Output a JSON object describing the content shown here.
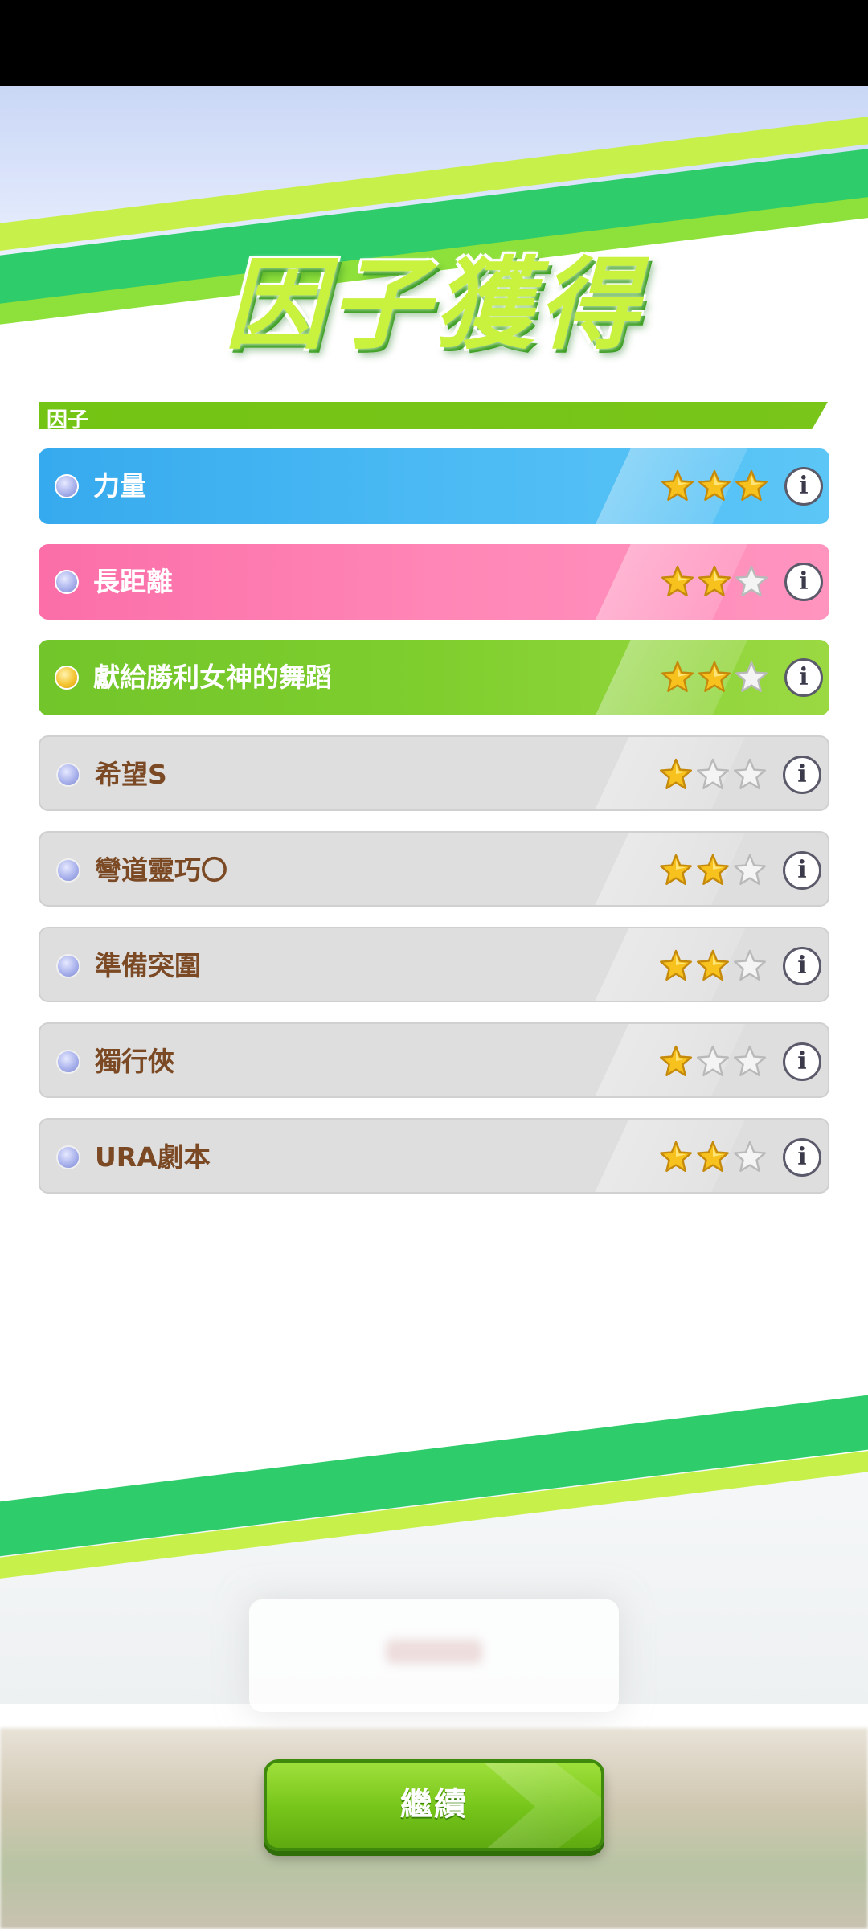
{
  "title": "因子獲得",
  "section_label": "因子",
  "factors": [
    {
      "name": "力量",
      "stars": 3,
      "color": "blue",
      "dot": "blue-gem-icon"
    },
    {
      "name": "長距離",
      "stars": 2,
      "color": "pink",
      "dot": "blue-gem-icon"
    },
    {
      "name": "獻給勝利女神的舞蹈",
      "stars": 2,
      "color": "green",
      "dot": "gold-gem-icon"
    },
    {
      "name": "希望S",
      "stars": 1,
      "color": "gray",
      "dot": "blue-gem-icon"
    },
    {
      "name": "彎道靈巧〇",
      "stars": 2,
      "color": "gray",
      "dot": "blue-gem-icon"
    },
    {
      "name": "準備突圍",
      "stars": 2,
      "color": "gray",
      "dot": "blue-gem-icon"
    },
    {
      "name": "獨行俠",
      "stars": 1,
      "color": "gray",
      "dot": "blue-gem-icon"
    },
    {
      "name": "URA劇本",
      "stars": 2,
      "color": "gray",
      "dot": "blue-gem-icon"
    }
  ],
  "max_stars": 3,
  "info_glyph": "i",
  "continue_label": "繼續",
  "colors": {
    "blue": "#4bbaf4",
    "pink": "#ff86b6",
    "green": "#7fce2e",
    "gray": "#dedede",
    "accent": "#75c41a"
  }
}
